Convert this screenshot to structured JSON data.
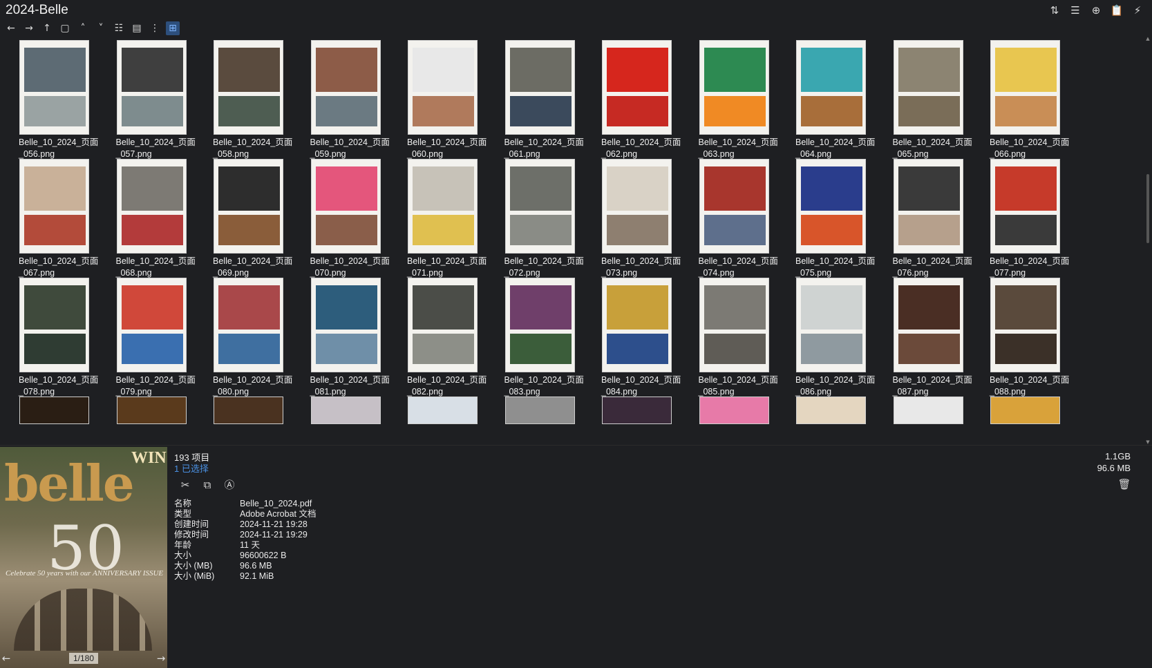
{
  "window": {
    "title": "2024-Belle"
  },
  "top_actions": [
    {
      "name": "sort-icon",
      "glyph": "⇅"
    },
    {
      "name": "list-view-icon",
      "glyph": "☰"
    },
    {
      "name": "add-icon",
      "glyph": "⊕"
    },
    {
      "name": "clipboard-icon",
      "glyph": "📋"
    },
    {
      "name": "pin-icon",
      "glyph": "⚡"
    }
  ],
  "toolbar": [
    {
      "name": "back-icon",
      "glyph": "←"
    },
    {
      "name": "forward-icon",
      "glyph": "→"
    },
    {
      "name": "up-icon",
      "glyph": "↑"
    },
    {
      "name": "window-icon",
      "glyph": "▢"
    },
    {
      "name": "chevron-up-icon",
      "glyph": "˄"
    },
    {
      "name": "chevron-down-icon",
      "glyph": "˅"
    },
    {
      "name": "details-view-icon",
      "glyph": "☷"
    },
    {
      "name": "tiles-view-icon",
      "glyph": "▤"
    },
    {
      "name": "tree-view-icon",
      "glyph": "⋮"
    },
    {
      "name": "thumbnail-view-icon",
      "glyph": "⊞",
      "active": true
    }
  ],
  "files": [
    "Belle_10_2024_页面_056.png",
    "Belle_10_2024_页面_057.png",
    "Belle_10_2024_页面_058.png",
    "Belle_10_2024_页面_059.png",
    "Belle_10_2024_页面_060.png",
    "Belle_10_2024_页面_061.png",
    "Belle_10_2024_页面_062.png",
    "Belle_10_2024_页面_063.png",
    "Belle_10_2024_页面_064.png",
    "Belle_10_2024_页面_065.png",
    "Belle_10_2024_页面_066.png",
    "Belle_10_2024_页面_067.png",
    "Belle_10_2024_页面_068.png",
    "Belle_10_2024_页面_069.png",
    "Belle_10_2024_页面_070.png",
    "Belle_10_2024_页面_071.png",
    "Belle_10_2024_页面_072.png",
    "Belle_10_2024_页面_073.png",
    "Belle_10_2024_页面_074.png",
    "Belle_10_2024_页面_075.png",
    "Belle_10_2024_页面_076.png",
    "Belle_10_2024_页面_077.png",
    "Belle_10_2024_页面_078.png",
    "Belle_10_2024_页面_079.png",
    "Belle_10_2024_页面_080.png",
    "Belle_10_2024_页面_081.png",
    "Belle_10_2024_页面_082.png",
    "Belle_10_2024_页面_083.png",
    "Belle_10_2024_页面_084.png",
    "Belle_10_2024_页面_085.png",
    "Belle_10_2024_页面_086.png",
    "Belle_10_2024_页面_087.png",
    "Belle_10_2024_页面_088.png"
  ],
  "thumb_colors": [
    [
      "#5d6b74",
      "#9aa3a3"
    ],
    [
      "#3f3f3f",
      "#7e8c8e"
    ],
    [
      "#5a4b3e",
      "#4e5d52"
    ],
    [
      "#8d5c48",
      "#6b7a82"
    ],
    [
      "#e8e8e8",
      "#b07a5c"
    ],
    [
      "#6c6c64",
      "#3b4a5c"
    ],
    [
      "#d6261d",
      "#c62a23"
    ],
    [
      "#2d8a52",
      "#f08a24"
    ],
    [
      "#3aa7b0",
      "#a86e3a"
    ],
    [
      "#8c8472",
      "#7a6d58"
    ],
    [
      "#e8c650",
      "#c98e56"
    ],
    [
      "#c9b199",
      "#b34b3a"
    ],
    [
      "#7d7a74",
      "#b33b3b"
    ],
    [
      "#2d2d2d",
      "#8a5d3a"
    ],
    [
      "#e4567c",
      "#8a5e4a"
    ],
    [
      "#c7c2b8",
      "#e0c050"
    ],
    [
      "#6d6f69",
      "#8a8c86"
    ],
    [
      "#d9d2c6",
      "#8e7f70"
    ],
    [
      "#a8362d",
      "#5e6f8c"
    ],
    [
      "#2a3d8c",
      "#d8552a"
    ],
    [
      "#3a3a3a",
      "#b6a08c"
    ],
    [
      "#c63a2a",
      "#3a3a3a"
    ],
    [
      "#3f4a3c",
      "#2f3c33"
    ],
    [
      "#d0483a",
      "#3a6fb0"
    ],
    [
      "#a9484a",
      "#3f6fa0"
    ],
    [
      "#2d5d7c",
      "#6f8fa8"
    ],
    [
      "#4b4d48",
      "#8d8f88"
    ],
    [
      "#6f3f6a",
      "#3b5d3a"
    ],
    [
      "#c8a03a",
      "#2d4f8c"
    ],
    [
      "#7c7a74",
      "#5f5c56"
    ],
    [
      "#cfd3d2",
      "#8f9aa0"
    ],
    [
      "#4a2e24",
      "#6b4a3a"
    ],
    [
      "#5a4a3c",
      "#3b3028"
    ]
  ],
  "partial_colors": [
    "#2a1e14",
    "#5a3a1c",
    "#4a3220",
    "#c6c0c6",
    "#d8dfe6",
    "#8f8f8f",
    "#3a2a3a",
    "#e77aa8",
    "#e4d6c0",
    "#e8e8e8",
    "#d9a23a"
  ],
  "bottom": {
    "item_count": "193 项目",
    "selected": "1 已选择",
    "total_size": "1.1GB",
    "selected_size": "96.6 MB",
    "actions": [
      {
        "name": "cut-icon",
        "glyph": "✂"
      },
      {
        "name": "copy-icon",
        "glyph": "⧉"
      },
      {
        "name": "rename-icon",
        "glyph": "Ⓐ"
      }
    ],
    "trash_glyph": "🗑",
    "properties": [
      {
        "k": "名称",
        "v": "Belle_10_2024.pdf"
      },
      {
        "k": "类型",
        "v": "Adobe Acrobat 文档"
      },
      {
        "k": "创建时间",
        "v": "2024-11-21  19:28"
      },
      {
        "k": "修改时间",
        "v": "2024-11-21  19:29"
      },
      {
        "k": "年龄",
        "v": "11 天"
      },
      {
        "k": "大小",
        "v": "96600622 B"
      },
      {
        "k": "大小 (MB)",
        "v": "96.6 MB"
      },
      {
        "k": "大小 (MiB)",
        "v": "92.1 MiB"
      }
    ]
  },
  "preview": {
    "brand": "belle",
    "number": "50",
    "badge": "WIN",
    "tagline": "Celebrate 50 years with our ANNIVERSARY ISSUE",
    "page": "1/180",
    "prev_glyph": "←",
    "next_glyph": "→"
  }
}
